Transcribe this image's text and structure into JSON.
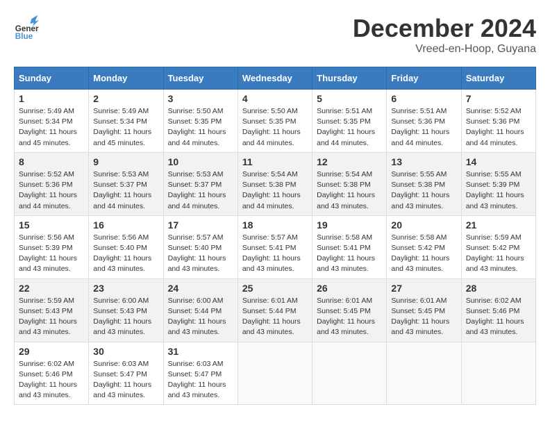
{
  "header": {
    "logo_line1": "General",
    "logo_line2": "Blue",
    "month": "December 2024",
    "location": "Vreed-en-Hoop, Guyana"
  },
  "days_of_week": [
    "Sunday",
    "Monday",
    "Tuesday",
    "Wednesday",
    "Thursday",
    "Friday",
    "Saturday"
  ],
  "weeks": [
    [
      {
        "day": "1",
        "rise": "5:49 AM",
        "set": "5:34 PM",
        "hours": "11 hours and 45 minutes."
      },
      {
        "day": "2",
        "rise": "5:49 AM",
        "set": "5:34 PM",
        "hours": "11 hours and 45 minutes."
      },
      {
        "day": "3",
        "rise": "5:50 AM",
        "set": "5:35 PM",
        "hours": "11 hours and 44 minutes."
      },
      {
        "day": "4",
        "rise": "5:50 AM",
        "set": "5:35 PM",
        "hours": "11 hours and 44 minutes."
      },
      {
        "day": "5",
        "rise": "5:51 AM",
        "set": "5:35 PM",
        "hours": "11 hours and 44 minutes."
      },
      {
        "day": "6",
        "rise": "5:51 AM",
        "set": "5:36 PM",
        "hours": "11 hours and 44 minutes."
      },
      {
        "day": "7",
        "rise": "5:52 AM",
        "set": "5:36 PM",
        "hours": "11 hours and 44 minutes."
      }
    ],
    [
      {
        "day": "8",
        "rise": "5:52 AM",
        "set": "5:36 PM",
        "hours": "11 hours and 44 minutes."
      },
      {
        "day": "9",
        "rise": "5:53 AM",
        "set": "5:37 PM",
        "hours": "11 hours and 44 minutes."
      },
      {
        "day": "10",
        "rise": "5:53 AM",
        "set": "5:37 PM",
        "hours": "11 hours and 44 minutes."
      },
      {
        "day": "11",
        "rise": "5:54 AM",
        "set": "5:38 PM",
        "hours": "11 hours and 44 minutes."
      },
      {
        "day": "12",
        "rise": "5:54 AM",
        "set": "5:38 PM",
        "hours": "11 hours and 43 minutes."
      },
      {
        "day": "13",
        "rise": "5:55 AM",
        "set": "5:38 PM",
        "hours": "11 hours and 43 minutes."
      },
      {
        "day": "14",
        "rise": "5:55 AM",
        "set": "5:39 PM",
        "hours": "11 hours and 43 minutes."
      }
    ],
    [
      {
        "day": "15",
        "rise": "5:56 AM",
        "set": "5:39 PM",
        "hours": "11 hours and 43 minutes."
      },
      {
        "day": "16",
        "rise": "5:56 AM",
        "set": "5:40 PM",
        "hours": "11 hours and 43 minutes."
      },
      {
        "day": "17",
        "rise": "5:57 AM",
        "set": "5:40 PM",
        "hours": "11 hours and 43 minutes."
      },
      {
        "day": "18",
        "rise": "5:57 AM",
        "set": "5:41 PM",
        "hours": "11 hours and 43 minutes."
      },
      {
        "day": "19",
        "rise": "5:58 AM",
        "set": "5:41 PM",
        "hours": "11 hours and 43 minutes."
      },
      {
        "day": "20",
        "rise": "5:58 AM",
        "set": "5:42 PM",
        "hours": "11 hours and 43 minutes."
      },
      {
        "day": "21",
        "rise": "5:59 AM",
        "set": "5:42 PM",
        "hours": "11 hours and 43 minutes."
      }
    ],
    [
      {
        "day": "22",
        "rise": "5:59 AM",
        "set": "5:43 PM",
        "hours": "11 hours and 43 minutes."
      },
      {
        "day": "23",
        "rise": "6:00 AM",
        "set": "5:43 PM",
        "hours": "11 hours and 43 minutes."
      },
      {
        "day": "24",
        "rise": "6:00 AM",
        "set": "5:44 PM",
        "hours": "11 hours and 43 minutes."
      },
      {
        "day": "25",
        "rise": "6:01 AM",
        "set": "5:44 PM",
        "hours": "11 hours and 43 minutes."
      },
      {
        "day": "26",
        "rise": "6:01 AM",
        "set": "5:45 PM",
        "hours": "11 hours and 43 minutes."
      },
      {
        "day": "27",
        "rise": "6:01 AM",
        "set": "5:45 PM",
        "hours": "11 hours and 43 minutes."
      },
      {
        "day": "28",
        "rise": "6:02 AM",
        "set": "5:46 PM",
        "hours": "11 hours and 43 minutes."
      }
    ],
    [
      {
        "day": "29",
        "rise": "6:02 AM",
        "set": "5:46 PM",
        "hours": "11 hours and 43 minutes."
      },
      {
        "day": "30",
        "rise": "6:03 AM",
        "set": "5:47 PM",
        "hours": "11 hours and 43 minutes."
      },
      {
        "day": "31",
        "rise": "6:03 AM",
        "set": "5:47 PM",
        "hours": "11 hours and 43 minutes."
      },
      null,
      null,
      null,
      null
    ]
  ],
  "labels": {
    "sunrise": "Sunrise:",
    "sunset": "Sunset:",
    "daylight": "Daylight:"
  }
}
